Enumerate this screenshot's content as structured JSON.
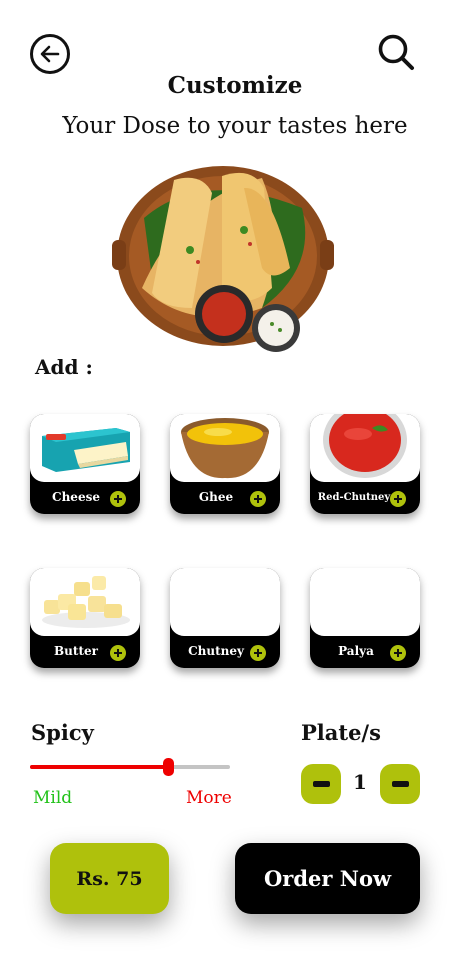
{
  "header": {
    "title": "Customize",
    "subtitle": "Your Dose to your tastes here",
    "back_icon": "back-arrow-icon",
    "search_icon": "search-icon"
  },
  "addons": {
    "label": "Add :",
    "items": [
      {
        "name": "Cheese",
        "image": "cheese-box"
      },
      {
        "name": "Ghee",
        "image": "ghee-bowl"
      },
      {
        "name": "Red-Chutney",
        "image": "red-chutney-bowl"
      },
      {
        "name": "Butter",
        "image": "butter-cubes"
      },
      {
        "name": "Chutney",
        "image": ""
      },
      {
        "name": "Palya",
        "image": ""
      }
    ]
  },
  "spicy": {
    "label": "Spicy",
    "min_label": "Mild",
    "max_label": "More",
    "level": 0.69
  },
  "plates": {
    "label": "Plate/s",
    "quantity": "1"
  },
  "footer": {
    "price": "Rs. 75",
    "order_label": "Order Now"
  },
  "colors": {
    "accent": "#afc10c",
    "spicy_red": "#ee0000",
    "mild_green": "#22c21a",
    "dark": "#000000"
  }
}
